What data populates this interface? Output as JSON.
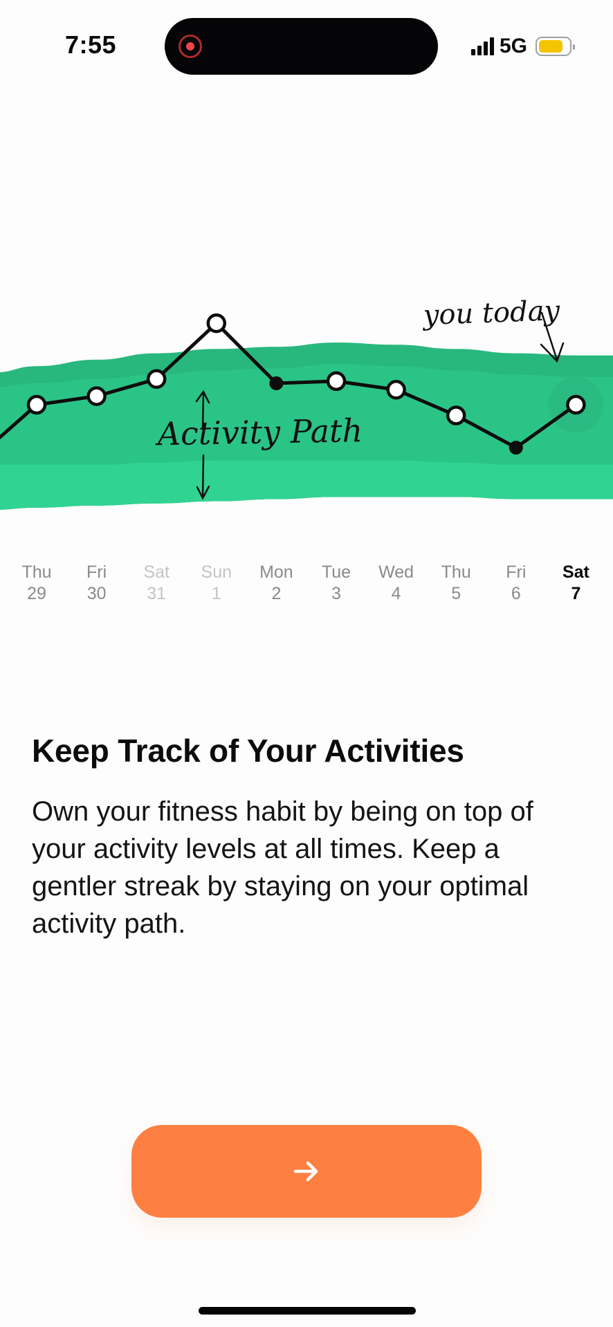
{
  "status_bar": {
    "time": "7:55",
    "network": "5G",
    "signal_bars": 4,
    "battery_level_pct": 80,
    "recording_indicator": true
  },
  "colors": {
    "band_top": "#28b87e",
    "band_middle": "#2bc487",
    "band_bottom": "#30d392",
    "accent_orange": "#fd8042",
    "line": "#0d0d0d",
    "battery": "#f5c400",
    "recording": "#f04545"
  },
  "chart_data": {
    "type": "line",
    "title": "",
    "xlabel": "",
    "ylabel": "",
    "annotations": {
      "path_label": "Activity Path",
      "today_label": "you today"
    },
    "categories": [
      "Thu 29",
      "Fri 30",
      "Sat 31",
      "Sun 1",
      "Mon 2",
      "Tue 3",
      "Wed 4",
      "Thu 5",
      "Fri 6",
      "Sat 7"
    ],
    "days": [
      {
        "weekday": "Thu",
        "date": "29",
        "state": "normal"
      },
      {
        "weekday": "Fri",
        "date": "30",
        "state": "normal"
      },
      {
        "weekday": "Sat",
        "date": "31",
        "state": "faded"
      },
      {
        "weekday": "Sun",
        "date": "1",
        "state": "faded"
      },
      {
        "weekday": "Mon",
        "date": "2",
        "state": "normal"
      },
      {
        "weekday": "Tue",
        "date": "3",
        "state": "normal"
      },
      {
        "weekday": "Wed",
        "date": "4",
        "state": "normal"
      },
      {
        "weekday": "Thu",
        "date": "5",
        "state": "normal"
      },
      {
        "weekday": "Fri",
        "date": "6",
        "state": "normal"
      },
      {
        "weekday": "Sat",
        "date": "7",
        "state": "today"
      }
    ],
    "series": [
      {
        "name": "Activity",
        "leading_value": 32,
        "values": [
          50,
          54,
          62,
          88,
          60,
          61,
          57,
          45,
          30,
          50
        ],
        "markers": [
          "open",
          "open",
          "open",
          "open",
          "filled",
          "open",
          "open",
          "open",
          "filled",
          "open"
        ]
      }
    ],
    "activity_path_band": {
      "upper": [
        68,
        71,
        74,
        76,
        77,
        79,
        78,
        76,
        74,
        73
      ],
      "inner_upper": [
        60,
        62,
        64,
        66,
        67,
        69,
        68,
        66,
        64,
        63
      ],
      "inner_lower": [
        22,
        22,
        23,
        24,
        24,
        24,
        24,
        23,
        22,
        22
      ],
      "lower": [
        2,
        3,
        4,
        5,
        6,
        7,
        7,
        7,
        6,
        6
      ]
    },
    "ylim": [
      0,
      100
    ],
    "grid": false,
    "legend": "none"
  },
  "onboarding": {
    "title": "Keep Track of Your Activities",
    "body": "Own your fitness habit by being on top of your activity levels at all times. Keep a gentler streak by staying on your optimal activity path."
  },
  "next_button": {
    "icon": "arrow-right-icon",
    "glyph": "→"
  }
}
